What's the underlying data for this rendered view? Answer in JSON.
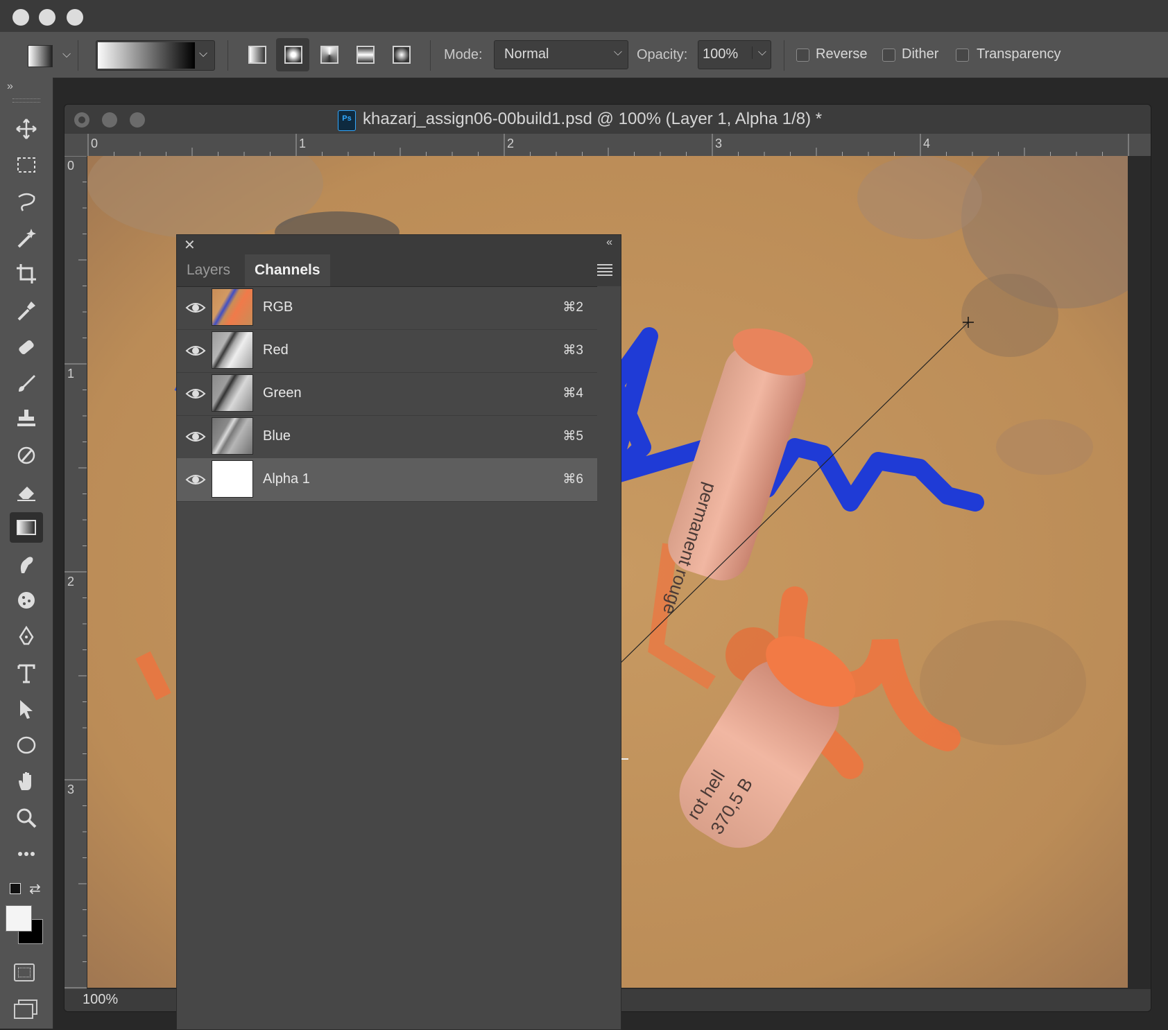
{
  "options": {
    "mode_label": "Mode:",
    "mode_value": "Normal",
    "opacity_label": "Opacity:",
    "opacity_value": "100%",
    "reverse_label": "Reverse",
    "dither_label": "Dither",
    "transparency_label": "Transparency"
  },
  "toolbar": {
    "collapse_label": "»",
    "tools": [
      "move-icon",
      "marquee-icon",
      "lasso-icon",
      "magic-wand-icon",
      "crop-icon",
      "eyedropper-icon",
      "healing-brush-icon",
      "brush-icon",
      "clone-stamp-icon",
      "history-brush-icon",
      "eraser-icon",
      "gradient-icon",
      "smudge-icon",
      "sponge-icon",
      "pen-icon",
      "type-icon",
      "path-select-icon",
      "ellipse-icon",
      "hand-icon",
      "zoom-icon",
      "more-tools-icon"
    ],
    "active_tool": "gradient-icon"
  },
  "document": {
    "title": "khazarj_assign06-00build1.psd @ 100% (Layer 1, Alpha 1/8) *",
    "zoom": "100%",
    "hruler": [
      "0",
      "1",
      "2",
      "3",
      "4"
    ],
    "vruler": [
      "0",
      "1",
      "2",
      "3"
    ]
  },
  "panel": {
    "tabs": [
      "Layers",
      "Channels"
    ],
    "active_tab": "Channels",
    "channels": [
      {
        "name": "RGB",
        "shortcut": "⌘2"
      },
      {
        "name": "Red",
        "shortcut": "⌘3"
      },
      {
        "name": "Green",
        "shortcut": "⌘4"
      },
      {
        "name": "Blue",
        "shortcut": "⌘5"
      },
      {
        "name": "Alpha 1",
        "shortcut": "⌘6"
      }
    ],
    "selected_channel": "Alpha 1"
  },
  "colors": {
    "chrome_bg": "#535353",
    "panel_bg": "#474747",
    "canvas_paper": "#c49560",
    "pastel_orange": "#f0733e",
    "pastel_blue": "#1f3bd6"
  }
}
